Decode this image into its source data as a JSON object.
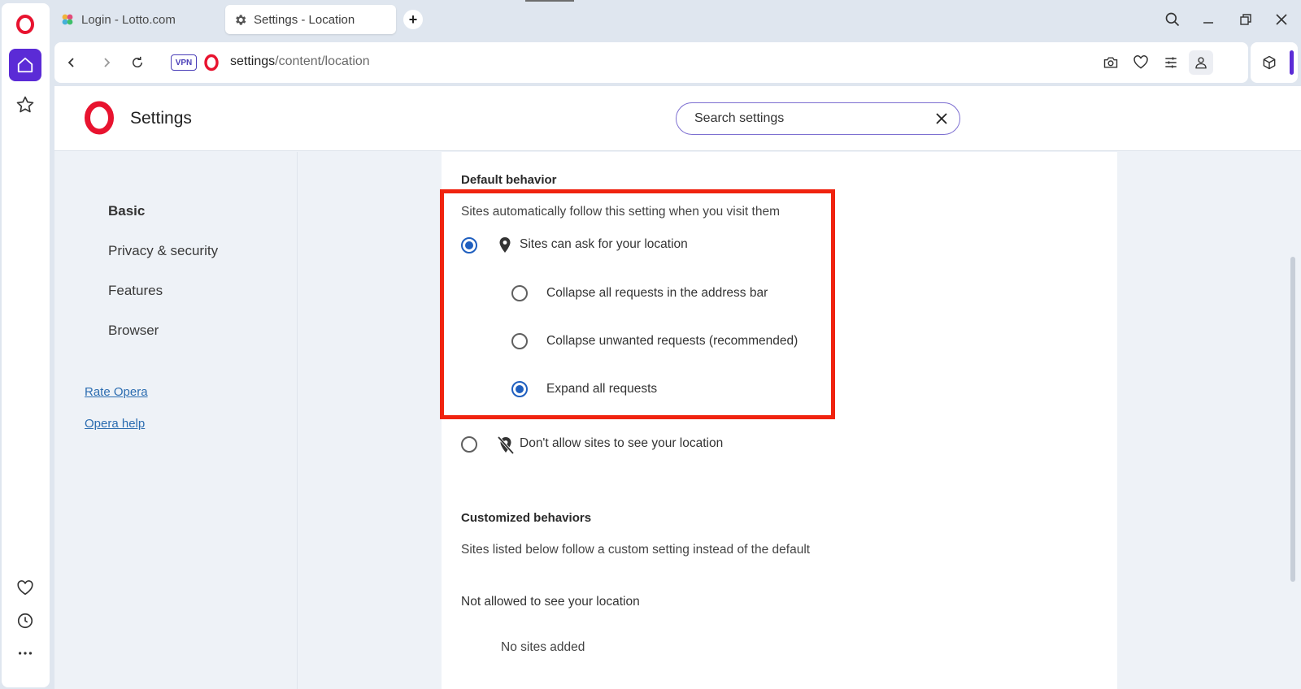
{
  "tabs": [
    {
      "title": "Login - Lotto.com",
      "active": false,
      "icon": "lotto-clover-icon"
    },
    {
      "title": "Settings - Location",
      "active": true,
      "icon": "gear-icon"
    }
  ],
  "new_tab_label": "+",
  "address_bar": {
    "vpn_label": "VPN",
    "url_host": "settings",
    "url_path": "/content/location"
  },
  "settings": {
    "title": "Settings",
    "search_value": "Search settings",
    "nav": {
      "items": [
        "Basic",
        "Privacy & security",
        "Features",
        "Browser"
      ],
      "links": [
        "Rate Opera",
        "Opera help"
      ]
    },
    "default_behavior": {
      "heading": "Default behavior",
      "description": "Sites automatically follow this setting when you visit them",
      "options": [
        {
          "label": "Sites can ask for your location",
          "selected": true
        },
        {
          "label": "Don't allow sites to see your location",
          "selected": false
        }
      ],
      "sub_options": [
        {
          "label": "Collapse all requests in the address bar",
          "selected": false
        },
        {
          "label": "Collapse unwanted requests (recommended)",
          "selected": false
        },
        {
          "label": "Expand all requests",
          "selected": true
        }
      ]
    },
    "customized_behaviors": {
      "heading": "Customized behaviors",
      "description": "Sites listed below follow a custom setting instead of the default",
      "not_allowed_heading": "Not allowed to see your location",
      "empty_text": "No sites added"
    }
  },
  "colors": {
    "accent": "#5b2bd6",
    "radio_selected": "#1f5fbf",
    "highlight": "#f0230f",
    "link": "#2b6cb0"
  }
}
